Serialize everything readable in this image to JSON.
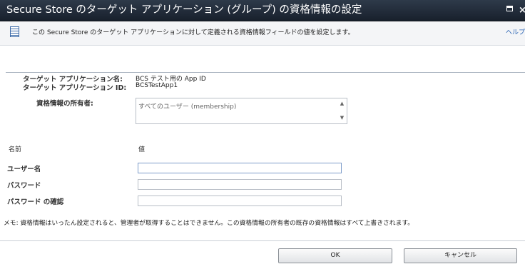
{
  "window": {
    "title": "Secure Store のターゲット アプリケーション (グループ) の資格情報の設定",
    "maximize_glyph": "□",
    "close_glyph": "×"
  },
  "infobar": {
    "text": "この Secure Store のターゲット アプリケーションに対して定義される資格情報フィールドの値を設定します。",
    "help_link": "ヘルプ"
  },
  "target_app": {
    "name_label": "ターゲット アプリケーション名:",
    "name_value": "BCS テスト用の App ID",
    "id_label": "ターゲット アプリケーション ID:",
    "id_value": "BCSTestApp1"
  },
  "owners": {
    "label": "資格情報の所有者:",
    "value": "すべてのユーザー (membership)",
    "scroll_up": "▲",
    "scroll_down": "▼"
  },
  "fields_header": {
    "name": "名前",
    "value": "値"
  },
  "fields": [
    {
      "label": "ユーザー名",
      "value": ""
    },
    {
      "label": "パスワード",
      "value": ""
    },
    {
      "label": "パスワード の確認",
      "value": ""
    }
  ],
  "note": "メモ: 資格情報はいったん設定されると、管理者が取得することはできません。この資格情報の所有者の既存の資格情報はすべて上書きされます。",
  "buttons": {
    "ok": "OK",
    "cancel": "キャンセル"
  }
}
